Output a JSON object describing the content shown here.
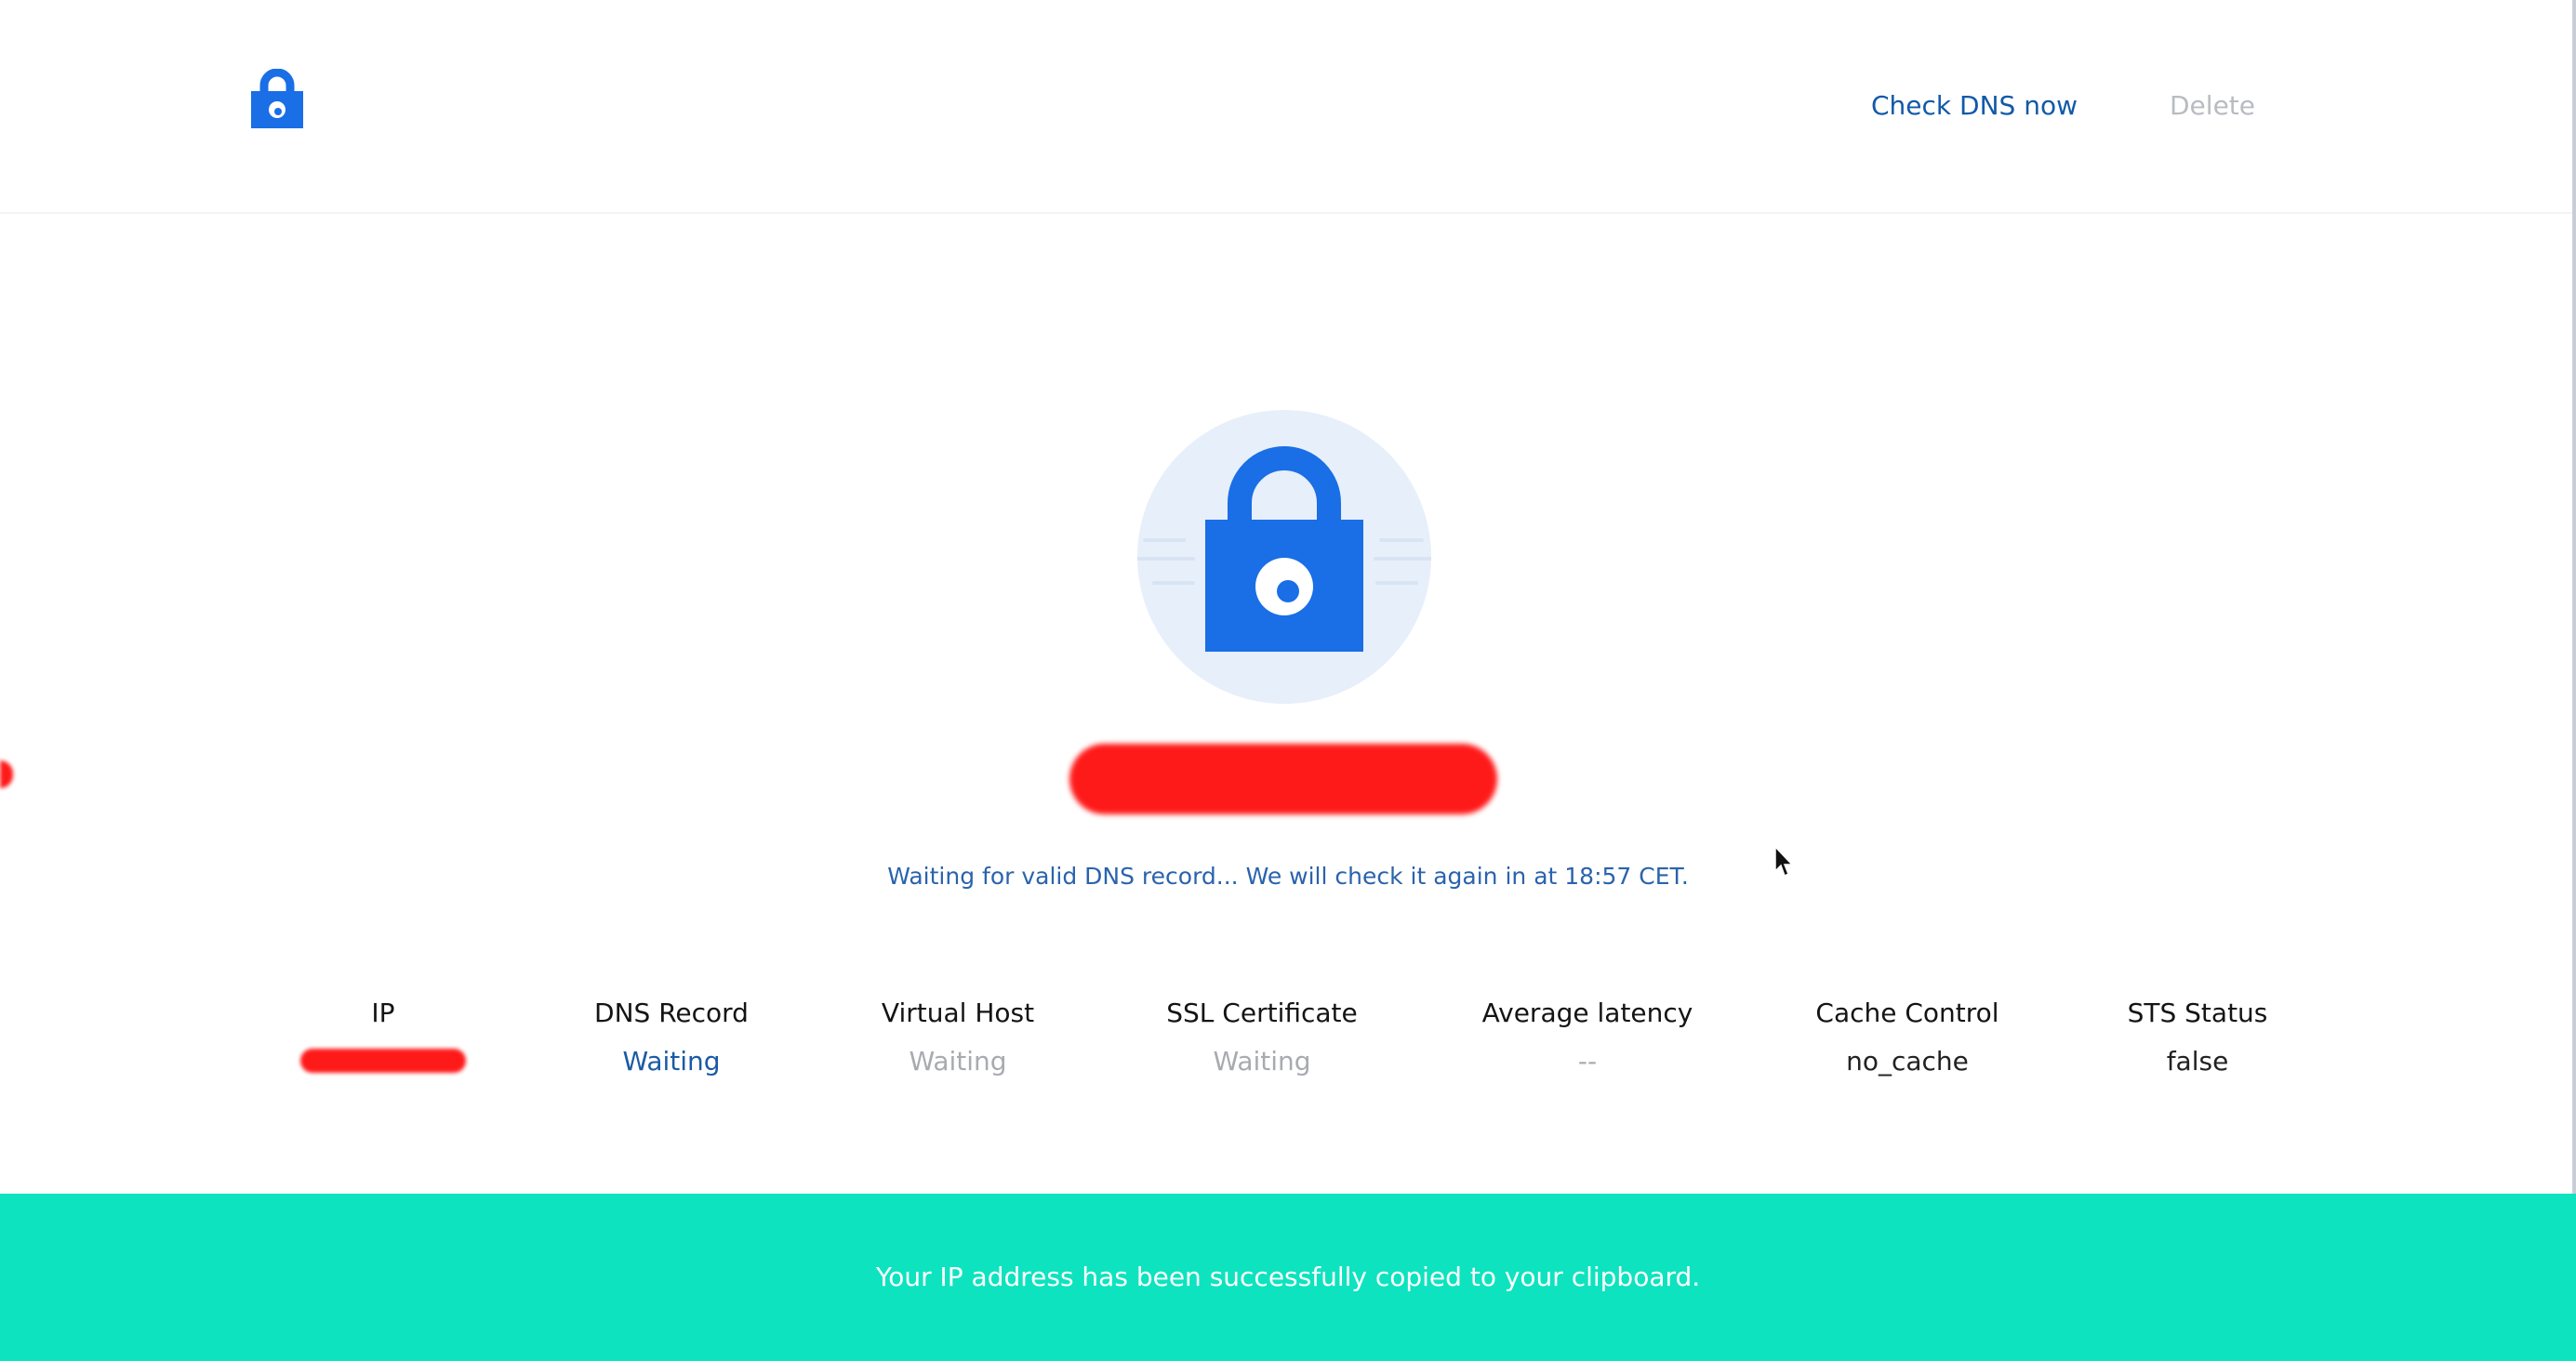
{
  "header": {
    "logo_icon": "lock-icon",
    "check_dns_label": "Check DNS now",
    "delete_label": "Delete"
  },
  "hero": {
    "icon": "lock-icon",
    "domain_redacted": true
  },
  "status_message": "Waiting for valid DNS record... We will check it again in at 18:57 CET.",
  "stats": [
    {
      "label": "IP",
      "value": "",
      "redacted": true
    },
    {
      "label": "DNS Record",
      "value": "Waiting"
    },
    {
      "label": "Virtual Host",
      "value": "Waiting"
    },
    {
      "label": "SSL Certificate",
      "value": "Waiting"
    },
    {
      "label": "Average latency",
      "value": "--"
    },
    {
      "label": "Cache Control",
      "value": "no_cache"
    },
    {
      "label": "STS Status",
      "value": "false"
    }
  ],
  "toast": {
    "message": "Your IP address has been successfully copied to your clipboard."
  },
  "colors": {
    "brand": "#1a6ee6",
    "link": "#1259a8",
    "toast_bg": "#0ee3bf",
    "redaction": "#ff1a1a"
  }
}
